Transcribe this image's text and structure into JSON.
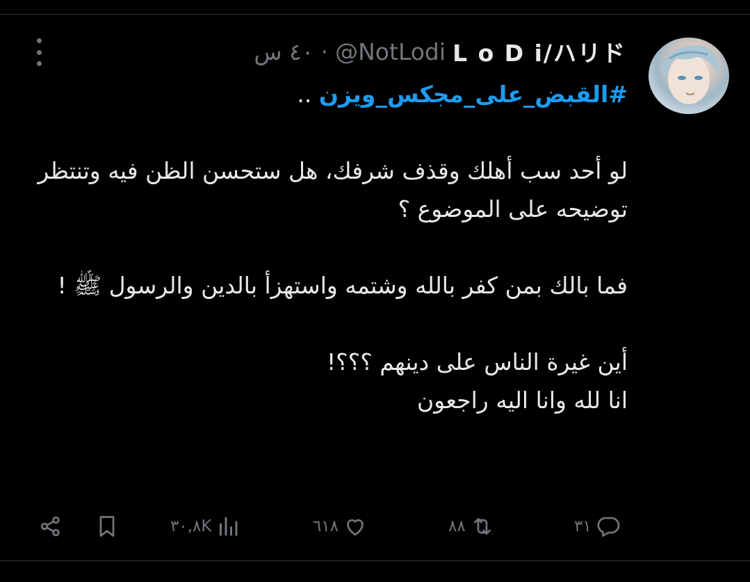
{
  "tweet": {
    "display_name": "L o D i/ハリド",
    "handle": "@NotLodi",
    "separator": "·",
    "time": "٤٠ س",
    "hashtag": "#القبض_على_مجكس_ويزن",
    "hashtag_suffix": " ..",
    "paragraphs": [
      "لو أحد سب أهلك وقذف شرفك، هل ستحسن الظن فيه وتنتظر توضيحه على الموضوع ؟",
      "فما بالك بمن كفر بالله وشتمه واستهزأ بالدين والرسول ﷺ !",
      "أين غيرة الناس على دينهم ؟؟؟!",
      "انا لله وانا اليه راجعون"
    ]
  },
  "actions": {
    "replies": "٣١",
    "retweets": "٨٨",
    "likes": "٦١٨",
    "views": "٣٠,٨K"
  },
  "colors": {
    "background": "#000000",
    "text": "#e7e9ea",
    "secondary": "#71767b",
    "accent": "#1d9bf0"
  },
  "icons": [
    "more-icon",
    "reply-icon",
    "retweet-icon",
    "like-icon",
    "views-icon",
    "bookmark-icon",
    "share-icon"
  ]
}
